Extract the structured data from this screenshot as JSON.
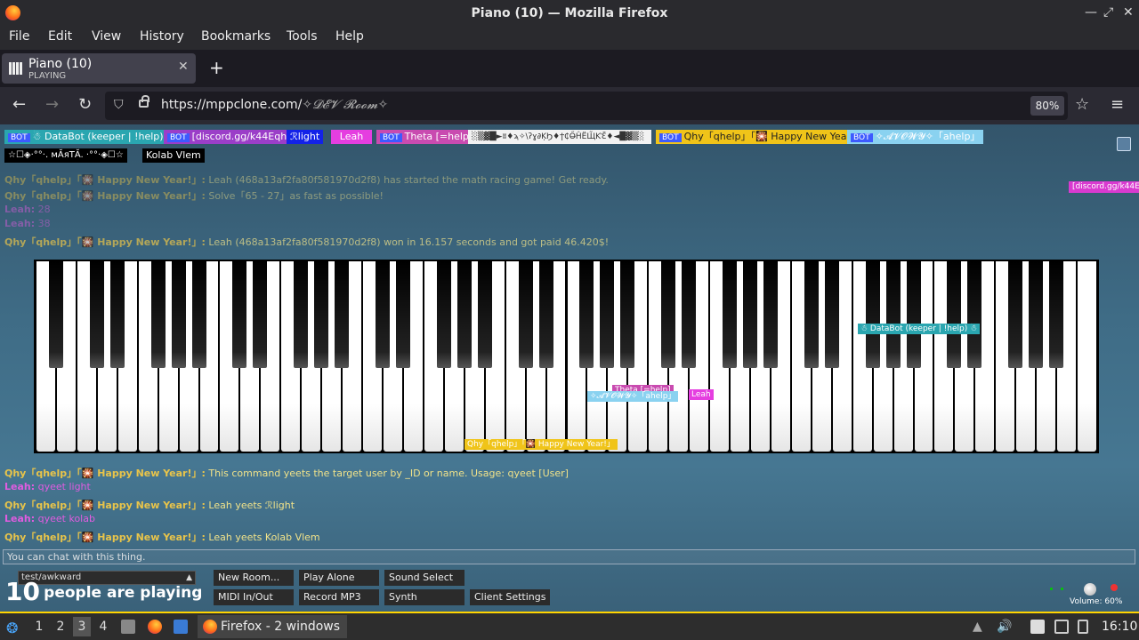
{
  "window": {
    "title": "Piano (10) — Mozilla Firefox"
  },
  "menu": [
    "File",
    "Edit",
    "View",
    "History",
    "Bookmarks",
    "Tools",
    "Help"
  ],
  "tab": {
    "title": "Piano (10)",
    "subtitle": "PLAYING"
  },
  "url": {
    "host": "https://mppclone.com/",
    "path": "✧𝓓𝓔𝓥 𝓡𝓸𝓸𝓶✧",
    "zoom": "80%"
  },
  "users": {
    "bot_badge": "BOT",
    "row1": [
      "☃ DataBot (keeper | !help) ☃",
      "[discord.gg/k44Eqha]",
      "ℛlight",
      "Leah",
      "Theta [=help]",
      "░▒▓█►ʬ♦ϡ✧\\ʔɣ∂ĶϦ♦ϯ₵Ő̶ĤЁЩ̃ƘƐ̃♦◄█▓▒░",
      "Qhy「qhelp」「🎇 Happy New Year!」",
      "✧𝓐𝓥𝓞𝓦𝓨✧「ahelp」"
    ],
    "row2": [
      "☆☐◈·°°·. мĂяТĂ. ·°°·◈☐☆",
      "Kolab Vlem"
    ],
    "side_tag": "[discord.gg/k44Eqh"
  },
  "chat": [
    {
      "name": "Qhy「qhelp」「🎇 Happy New Year!」:",
      "text": "Leah (468a13af2fa80f581970d2f8) has started the math racing game! Get ready.",
      "kind": "qhy"
    },
    {
      "name": "Qhy「qhelp」「🎇 Happy New Year!」:",
      "text": "Solve「65 - 27」as fast as possible!",
      "kind": "qhy"
    },
    {
      "name": "Leah:",
      "text": "28",
      "kind": "leah"
    },
    {
      "name": "Leah:",
      "text": "38",
      "kind": "leah"
    },
    {
      "name": "Qhy「qhelp」「🎇 Happy New Year!」:",
      "text": "Leah (468a13af2fa80f581970d2f8) won in 16.157 seconds and got paid 46.420$!",
      "kind": "qhy"
    }
  ],
  "chat_bottom": [
    {
      "name": "Qhy「qhelp」「🎇 Happy New Year!」:",
      "text": "This command yeets the target user by _ID or name. Usage: qyeet [User]",
      "kind": "qhy"
    },
    {
      "name": "Leah:",
      "text": "qyeet light",
      "kind": "leah"
    },
    {
      "name": "Qhy「qhelp」「🎇 Happy New Year!」:",
      "text": "Leah yeets ℛlight",
      "kind": "qhy"
    },
    {
      "name": "Leah:",
      "text": "qyeet kolab",
      "kind": "leah"
    },
    {
      "name": "Qhy「qhelp」「🎇 Happy New Year!」:",
      "text": "Leah yeets Kolab Vlem",
      "kind": "qhy"
    }
  ],
  "piano_tags": {
    "databot": "☃ DataBot (keeper | !help) ☃",
    "theta": "Theta [=help]",
    "avowy": "✧𝓐𝓥𝓞𝓦𝓨✧「ahelp」",
    "leah": "Leah",
    "qhy": "Qhy「qhelp」「🎇 Happy New Year!」"
  },
  "chat_input": {
    "placeholder": "You can chat with this thing."
  },
  "room": {
    "name": "test/awkward",
    "count": "10",
    "count_label": "people are playing"
  },
  "buttons": {
    "new_room": "New Room...",
    "play_alone": "Play Alone",
    "sound_select": "Sound Select",
    "midi": "MIDI In/Out",
    "record": "Record MP3",
    "synth": "Synth",
    "client_settings": "Client Settings"
  },
  "volume": {
    "label": "Volume: 60%"
  },
  "taskbar": {
    "workspaces": [
      "1",
      "2",
      "3",
      "4"
    ],
    "window": "Firefox - 2 windows",
    "clock": "16:10"
  }
}
